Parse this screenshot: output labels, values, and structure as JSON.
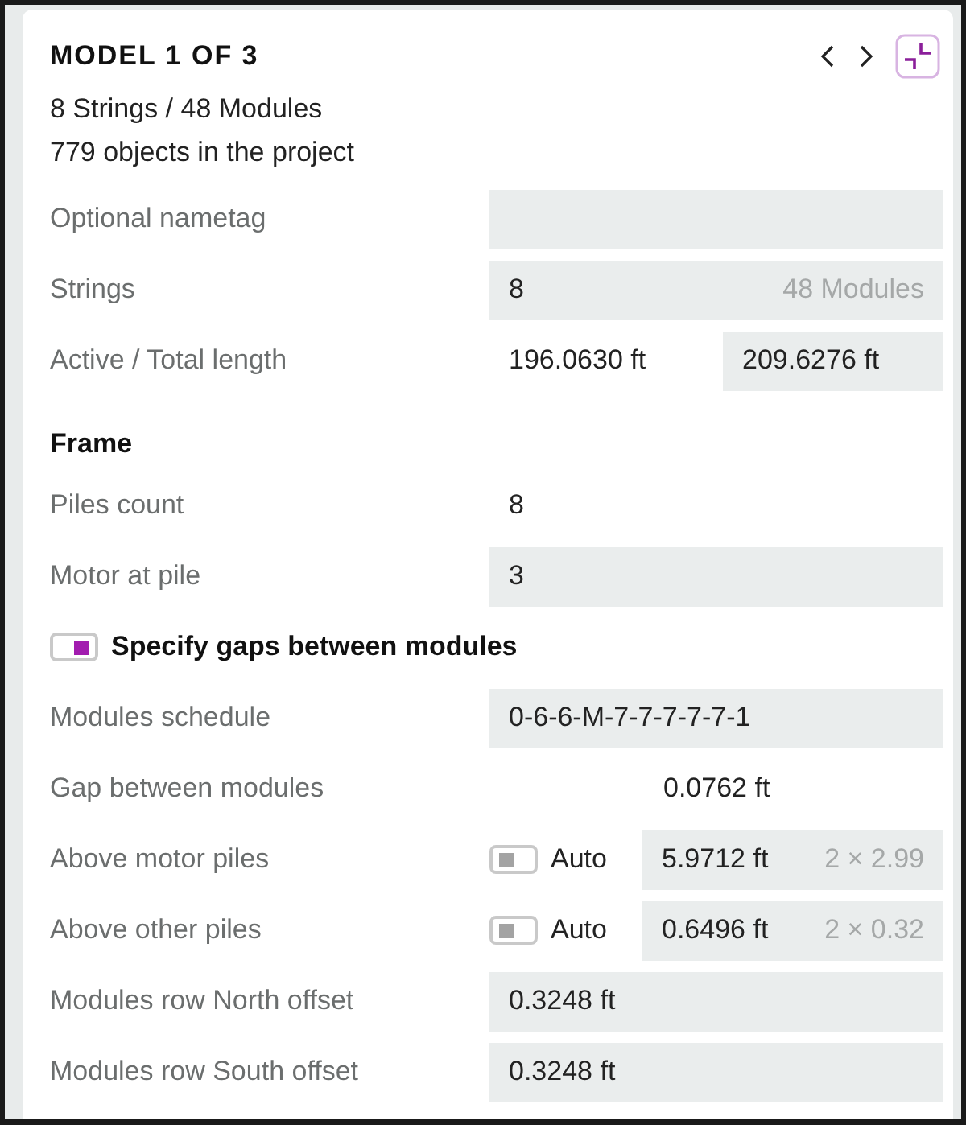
{
  "header": {
    "title": "MODEL 1 OF 3",
    "lines": [
      "8 Strings / 48 Modules",
      "779 objects in the project"
    ]
  },
  "rows": [
    {
      "kind": "field",
      "label": "Optional nametag"
    },
    {
      "kind": "field",
      "label": "Strings",
      "value": "8",
      "hint": "48 Modules"
    },
    {
      "kind": "split",
      "label": "Active / Total length",
      "value": "196.0630 ft",
      "field_value": "209.6276 ft"
    },
    {
      "kind": "heading",
      "label": "Frame"
    },
    {
      "kind": "plain",
      "label": "Piles count",
      "value": "8"
    },
    {
      "kind": "field",
      "label": "Motor at pile",
      "value": "3"
    },
    {
      "kind": "switch",
      "label": "Specify gaps between modules",
      "checked": true
    },
    {
      "kind": "field",
      "label": "Modules schedule",
      "value": "0-6-6-M-7-7-7-7-7-1"
    },
    {
      "kind": "indented",
      "label": "Gap between modules",
      "value": "0.0762 ft"
    },
    {
      "kind": "auto",
      "label": "Above motor piles",
      "switch_label": "Auto",
      "checked": false,
      "value": "5.9712 ft",
      "hint": "2 × 2.99"
    },
    {
      "kind": "auto",
      "label": "Above other piles",
      "switch_label": "Auto",
      "checked": false,
      "value": "0.6496 ft",
      "hint": "2 × 0.32"
    },
    {
      "kind": "field",
      "label": "Modules row North offset",
      "value": "0.3248 ft"
    },
    {
      "kind": "field",
      "label": "Modules row South offset",
      "value": "0.3248 ft"
    }
  ]
}
